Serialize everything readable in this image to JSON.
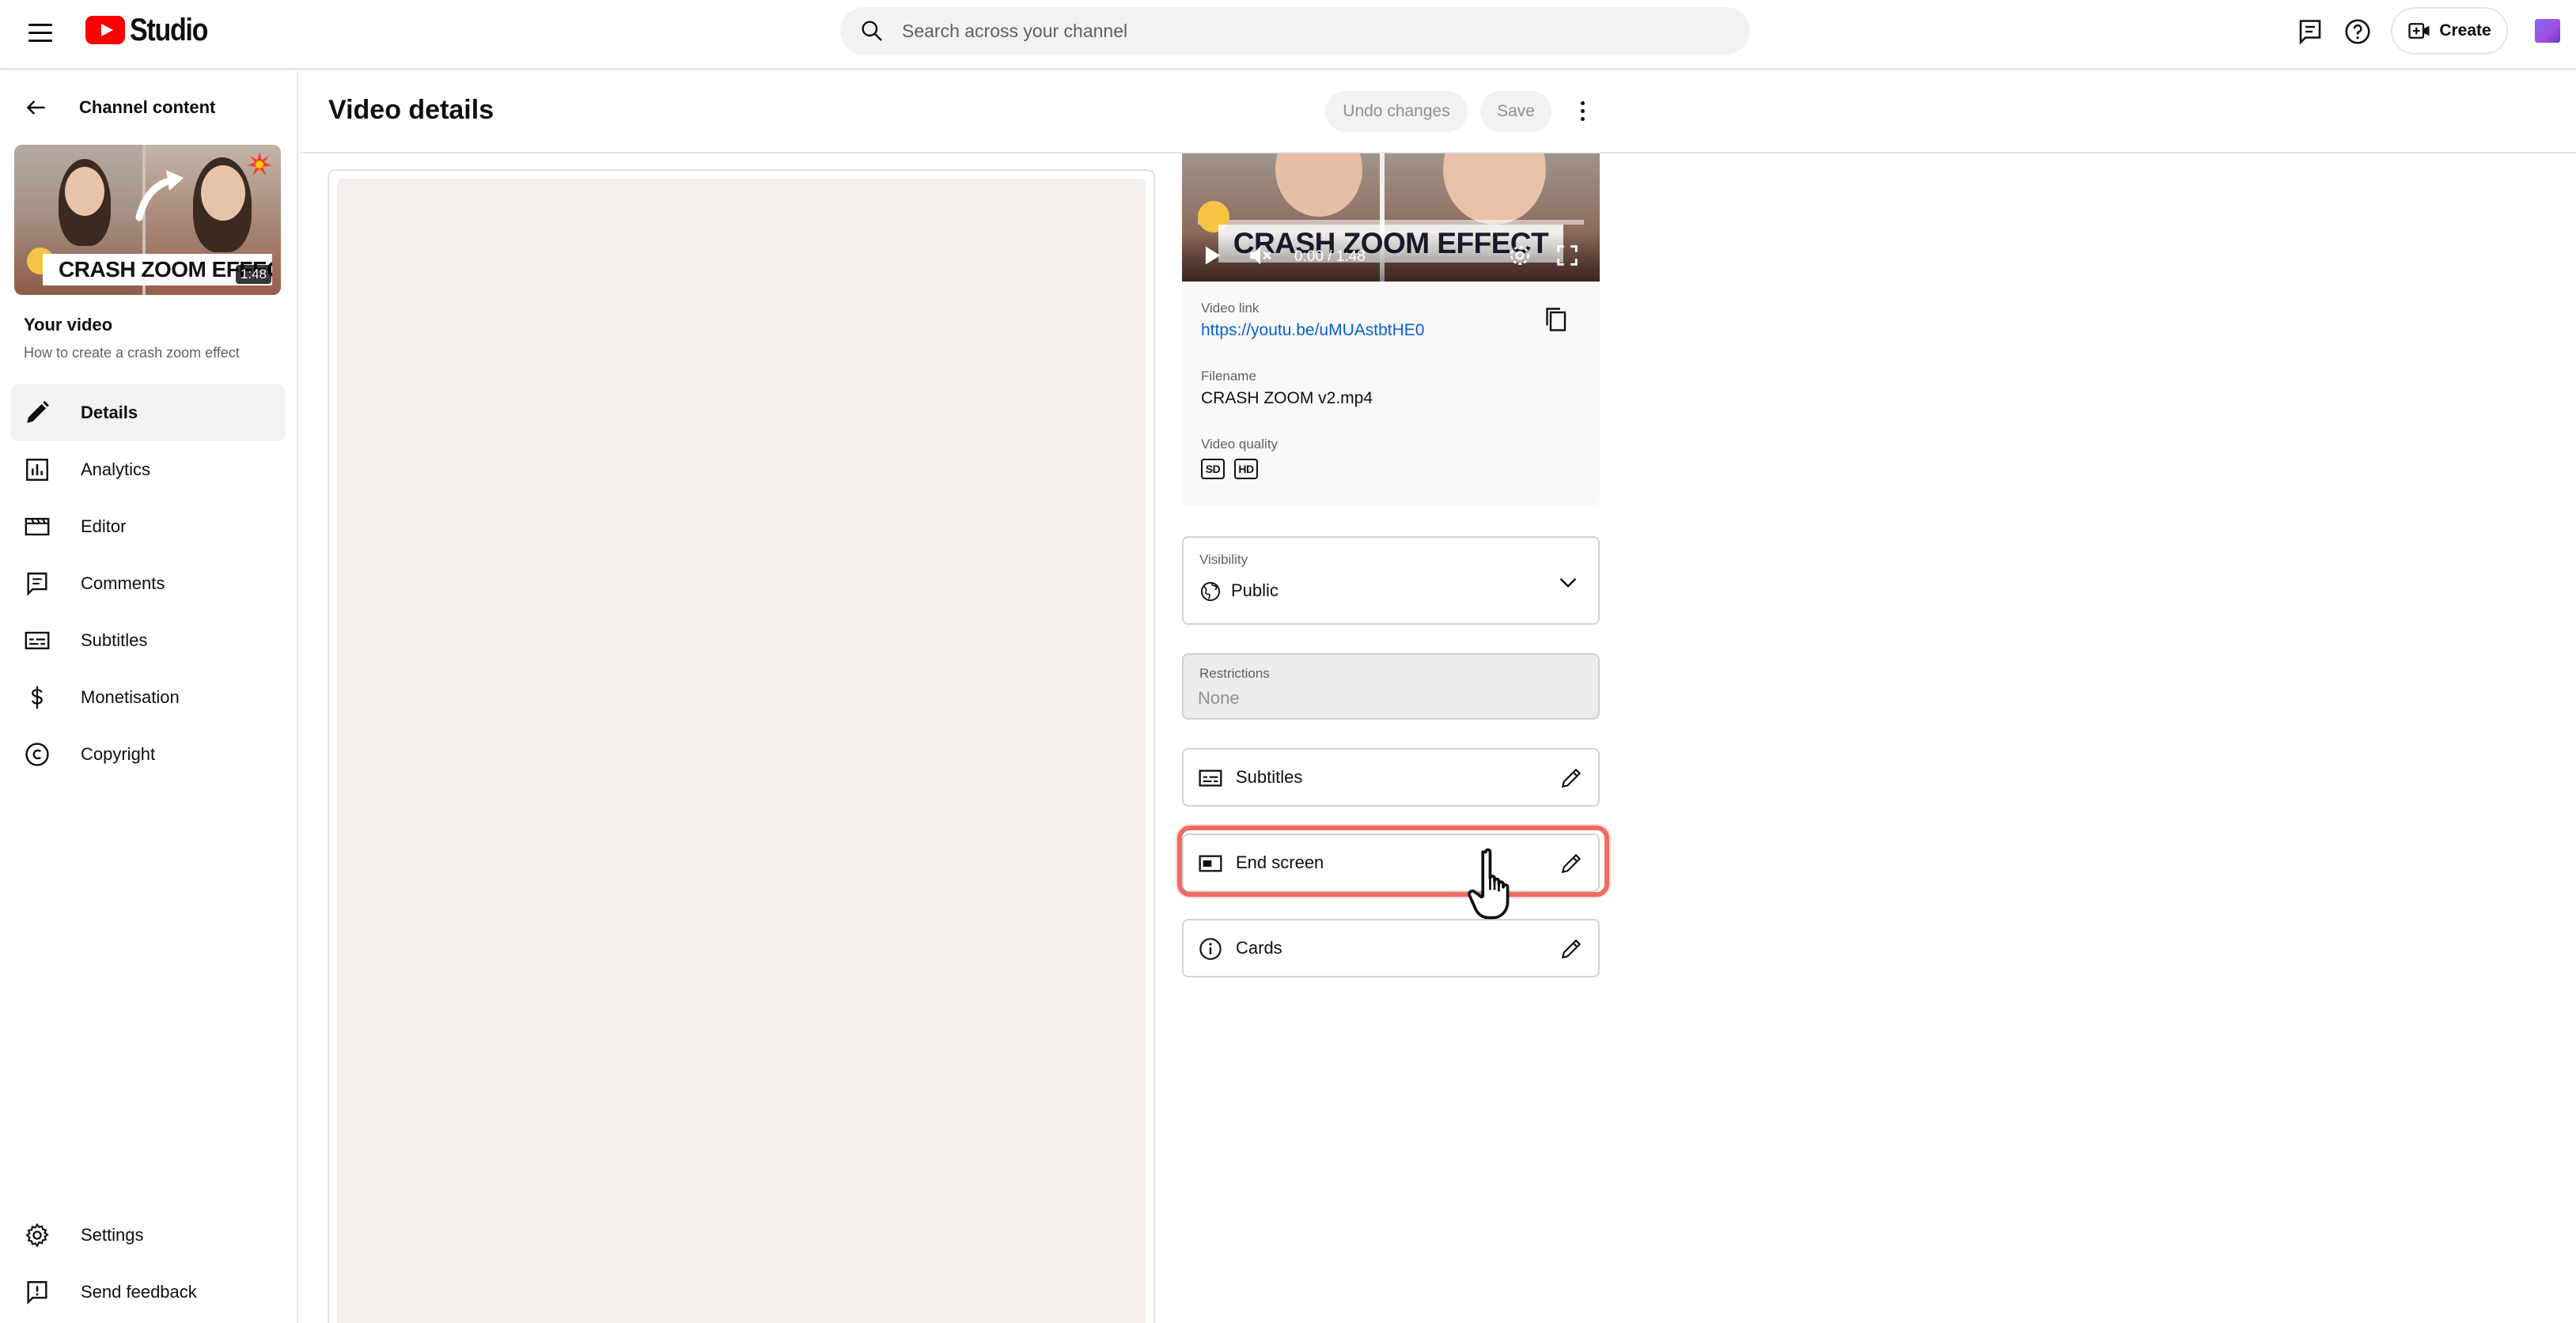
{
  "app": {
    "logo_text": "Studio",
    "search_placeholder": "Search across your channel",
    "create_label": "Create"
  },
  "sidebar": {
    "back_label": "Channel content",
    "thumbnail_caption": "CRASH ZOOM EFFECT",
    "thumbnail_duration": "1:48",
    "your_video_label": "Your video",
    "video_title": "How to create a crash zoom effect",
    "items": [
      {
        "label": "Details",
        "icon": "pencil-icon",
        "active": true
      },
      {
        "label": "Analytics",
        "icon": "analytics-icon",
        "active": false
      },
      {
        "label": "Editor",
        "icon": "editor-icon",
        "active": false
      },
      {
        "label": "Comments",
        "icon": "comments-icon",
        "active": false
      },
      {
        "label": "Subtitles",
        "icon": "subtitles-icon",
        "active": false
      },
      {
        "label": "Monetisation",
        "icon": "dollar-icon",
        "active": false
      },
      {
        "label": "Copyright",
        "icon": "copyright-icon",
        "active": false
      }
    ],
    "bottom_items": [
      {
        "label": "Settings",
        "icon": "gear-icon"
      },
      {
        "label": "Send feedback",
        "icon": "feedback-icon"
      }
    ]
  },
  "header": {
    "title": "Video details",
    "undo_label": "Undo changes",
    "save_label": "Save"
  },
  "preview": {
    "player_caption": "CRASH ZOOM EFFECT",
    "time": "0:00 / 1:48",
    "video_link_label": "Video link",
    "video_link": "https://youtu.be/uMUAstbtHE0",
    "filename_label": "Filename",
    "filename": "CRASH ZOOM v2.mp4",
    "quality_label": "Video quality",
    "quality_badges": [
      "SD",
      "HD"
    ]
  },
  "visibility": {
    "label": "Visibility",
    "value": "Public"
  },
  "restrictions": {
    "label": "Restrictions",
    "value": "None"
  },
  "options": [
    {
      "label": "Subtitles",
      "icon": "subtitles-icon"
    },
    {
      "label": "End screen",
      "icon": "end-screen-icon"
    },
    {
      "label": "Cards",
      "icon": "info-icon"
    }
  ],
  "colors": {
    "accent_link": "#065fd4",
    "highlight": "#ee6b63",
    "brand_red": "#ff0000"
  }
}
